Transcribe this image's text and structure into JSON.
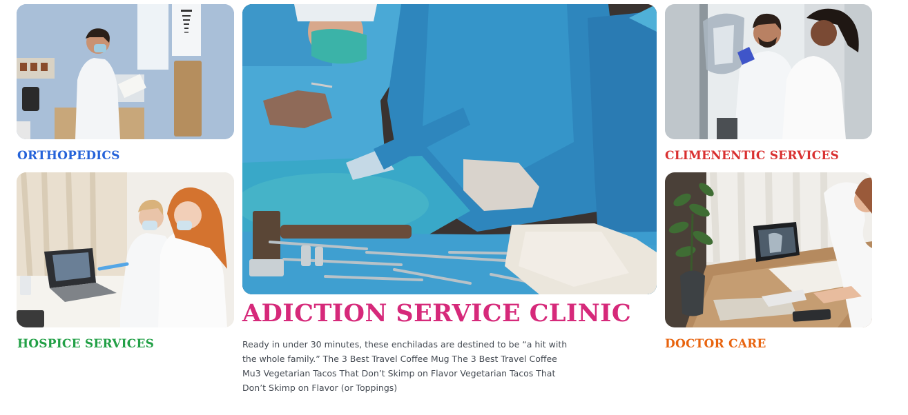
{
  "cards": {
    "orthopedics": {
      "title": "ORTHOPEDICS",
      "color": "#2563d9",
      "image": "doctor-writing-clipboard-photo"
    },
    "hospice": {
      "title": "HOSPICE SERVICES",
      "color": "#22a046",
      "image": "doctors-reviewing-xray-laptop-photo"
    },
    "climenentic": {
      "title": "CLIMENENTIC SERVICES",
      "color": "#d93030",
      "image": "doctors-examining-xray-film-photo"
    },
    "doctor_care": {
      "title": "DOCTOR CARE",
      "color": "#e8640f",
      "image": "doctor-desk-tablet-xray-photo"
    }
  },
  "feature": {
    "title": "ADICTION SERVICE CLINIC",
    "title_color": "#d6297a",
    "image": "surgeons-operating-room-photo",
    "description": "Ready in under 30 minutes, these enchiladas are destined to be “a hit with the whole family.” The 3 Best Travel Coffee Mug The 3 Best Travel Coffee Mu3 Vegetarian Tacos That Don’t Skimp on Flavor Vegetarian Tacos That Don’t Skimp on Flavor (or Toppings)"
  }
}
